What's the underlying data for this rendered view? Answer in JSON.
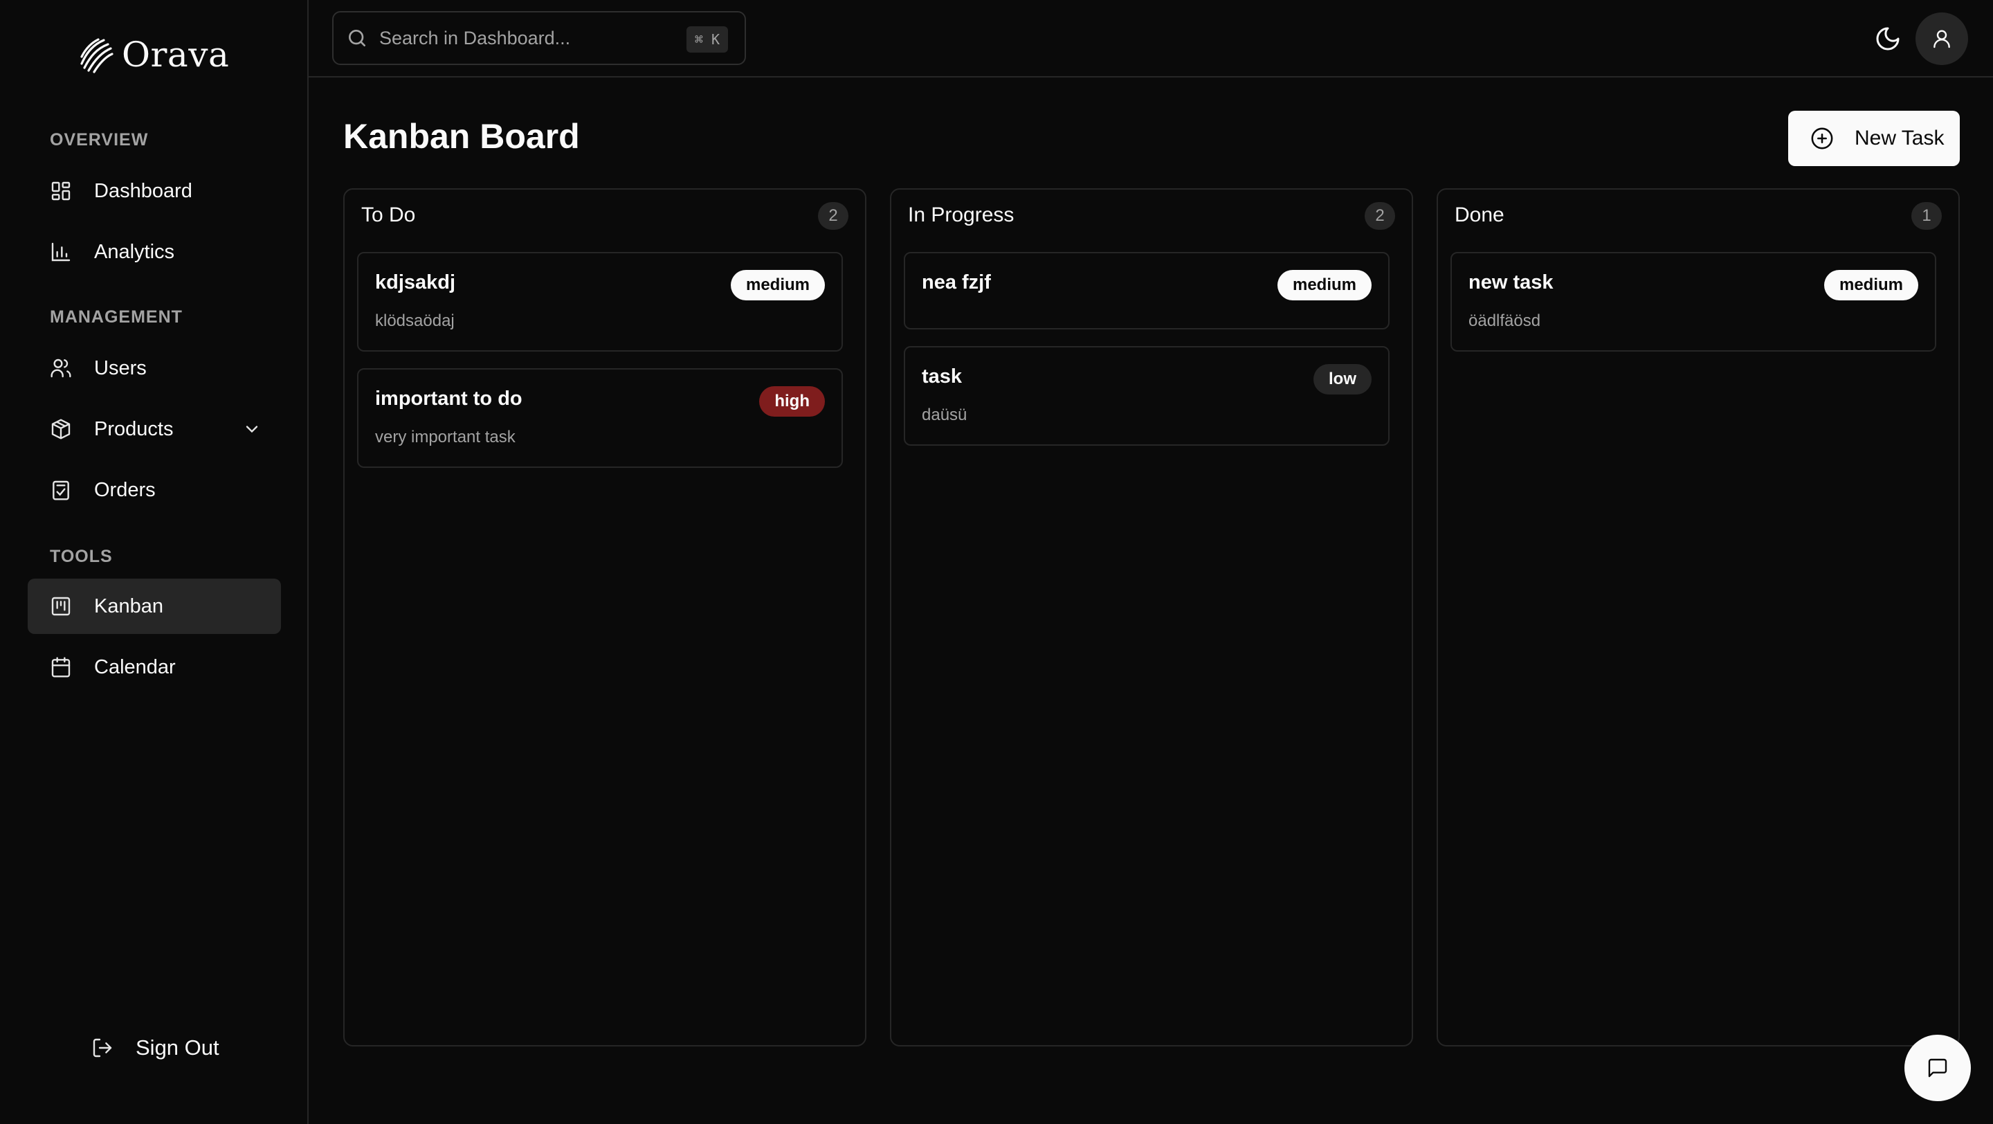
{
  "brand": {
    "name": "Orava"
  },
  "sidebar": {
    "sections": [
      {
        "label": "OVERVIEW",
        "items": [
          {
            "label": "Dashboard",
            "icon": "grid-icon"
          },
          {
            "label": "Analytics",
            "icon": "bar-chart-icon"
          }
        ]
      },
      {
        "label": "MANAGEMENT",
        "items": [
          {
            "label": "Users",
            "icon": "users-icon"
          },
          {
            "label": "Products",
            "icon": "package-icon"
          },
          {
            "label": "Orders",
            "icon": "clipboard-check-icon"
          }
        ]
      },
      {
        "label": "TOOLS",
        "items": [
          {
            "label": "Kanban",
            "icon": "kanban-icon",
            "active": true
          },
          {
            "label": "Calendar",
            "icon": "calendar-icon"
          }
        ]
      }
    ],
    "signout_label": "Sign Out"
  },
  "topbar": {
    "search_placeholder": "Search in Dashboard...",
    "shortcut": "⌘ K"
  },
  "main": {
    "title": "Kanban Board",
    "new_task_label": "New Task",
    "columns": [
      {
        "title": "To Do",
        "count": "2",
        "cards": [
          {
            "title": "kdjsakdj",
            "description": "klödsaödaj",
            "priority": "medium"
          },
          {
            "title": "important to do",
            "description": "very important task",
            "priority": "high"
          }
        ]
      },
      {
        "title": "In Progress",
        "count": "2",
        "cards": [
          {
            "title": "nea fzjf",
            "description": "",
            "priority": "medium"
          },
          {
            "title": "task",
            "description": "daüsü",
            "priority": "low"
          }
        ]
      },
      {
        "title": "Done",
        "count": "1",
        "cards": [
          {
            "title": "new task",
            "description": "öädlfäösd",
            "priority": "medium"
          }
        ]
      }
    ]
  },
  "colors": {
    "background": "#0a0a0a",
    "border": "#262626",
    "high": "#7f1d1d",
    "muted": "#a3a3a3"
  }
}
